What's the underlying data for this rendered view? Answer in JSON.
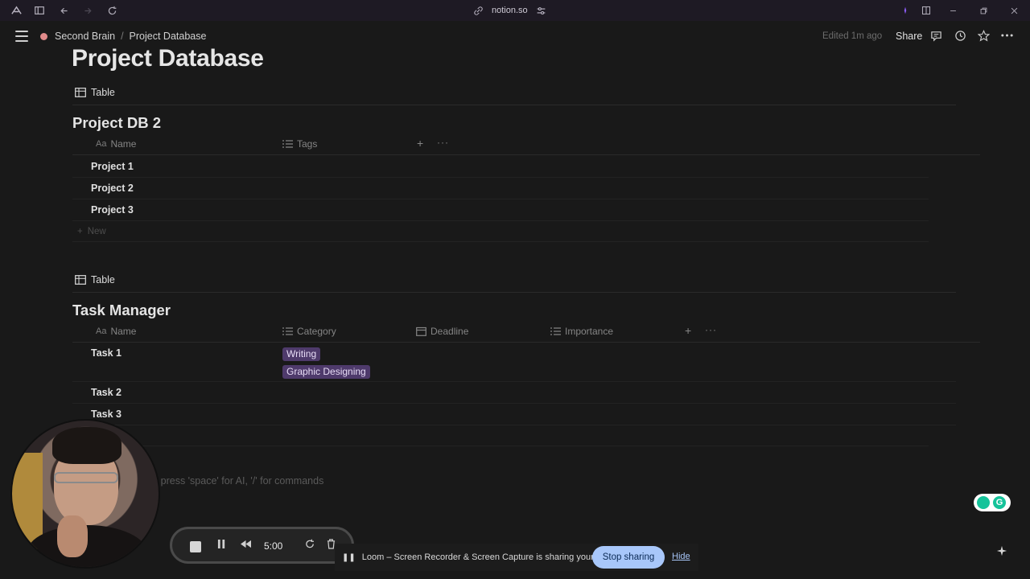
{
  "browser": {
    "url": "notion.so"
  },
  "topbar": {
    "breadcrumbs": [
      "Second Brain",
      "Project Database"
    ],
    "separator": "/",
    "edited": "Edited 1m ago",
    "share_label": "Share"
  },
  "page": {
    "title": "Project Database"
  },
  "project_db": {
    "view_label": "Table",
    "title": "Project DB 2",
    "columns": [
      {
        "icon": "Aa",
        "label": "Name"
      },
      {
        "icon": "list-icon",
        "label": "Tags"
      }
    ],
    "rows": [
      "Project 1",
      "Project 2",
      "Project 3"
    ],
    "new_label": "New"
  },
  "task_db": {
    "view_label": "Table",
    "title": "Task Manager",
    "columns": [
      {
        "icon": "Aa",
        "label": "Name"
      },
      {
        "icon": "list-icon",
        "label": "Category"
      },
      {
        "icon": "calendar-icon",
        "label": "Deadline"
      },
      {
        "icon": "list-icon",
        "label": "Importance"
      }
    ],
    "rows": [
      {
        "name": "Task 1",
        "categories": [
          "Writing",
          "Graphic Designing"
        ]
      },
      {
        "name": "Task 2",
        "categories": []
      },
      {
        "name": "Task 3",
        "categories": []
      }
    ]
  },
  "editor": {
    "placeholder": "r press 'space' for AI, '/' for commands"
  },
  "loom": {
    "timer": "5:00"
  },
  "sharing_bar": {
    "message": "Loom – Screen Recorder & Screen Capture is sharing your screen.",
    "stop_label": "Stop sharing",
    "hide_label": "Hide"
  },
  "colors": {
    "background": "#191919",
    "tag_bg": "#4e3a6b",
    "stop_share_bg": "#a8c7fa"
  }
}
